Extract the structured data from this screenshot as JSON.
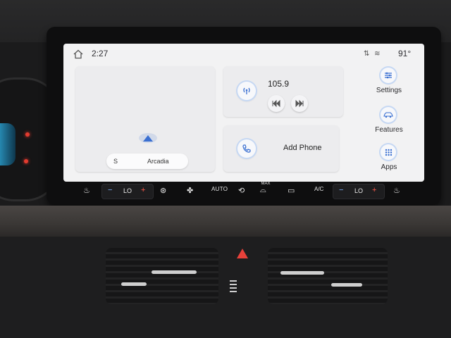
{
  "statusbar": {
    "time": "2:27",
    "temperature": "91°",
    "icons": [
      "home-icon",
      "no-signal-icon",
      "no-wifi-icon"
    ]
  },
  "map": {
    "street_direction": "S",
    "street_name": "Arcadia"
  },
  "radio": {
    "frequency": "105.9",
    "icons": [
      "radio-antenna-icon",
      "seek-back-icon",
      "seek-forward-icon"
    ]
  },
  "phone": {
    "label": "Add Phone",
    "icon": "phone-icon"
  },
  "sidebar": {
    "items": [
      {
        "label": "Settings",
        "icon": "sliders-icon"
      },
      {
        "label": "Features",
        "icon": "car-icon"
      },
      {
        "label": "Apps",
        "icon": "apps-grid-icon"
      }
    ]
  },
  "climate": {
    "driver_temp": "LO",
    "passenger_temp": "LO",
    "auto_label": "AUTO",
    "max_label": "MAX",
    "ac_label": "A/C",
    "minus": "−",
    "plus": "+"
  },
  "colors": {
    "screen_bg": "#f2f2f3",
    "card_bg": "#ececee",
    "accent_blue": "#3a6fd1",
    "hazard_red": "#e8413a"
  }
}
